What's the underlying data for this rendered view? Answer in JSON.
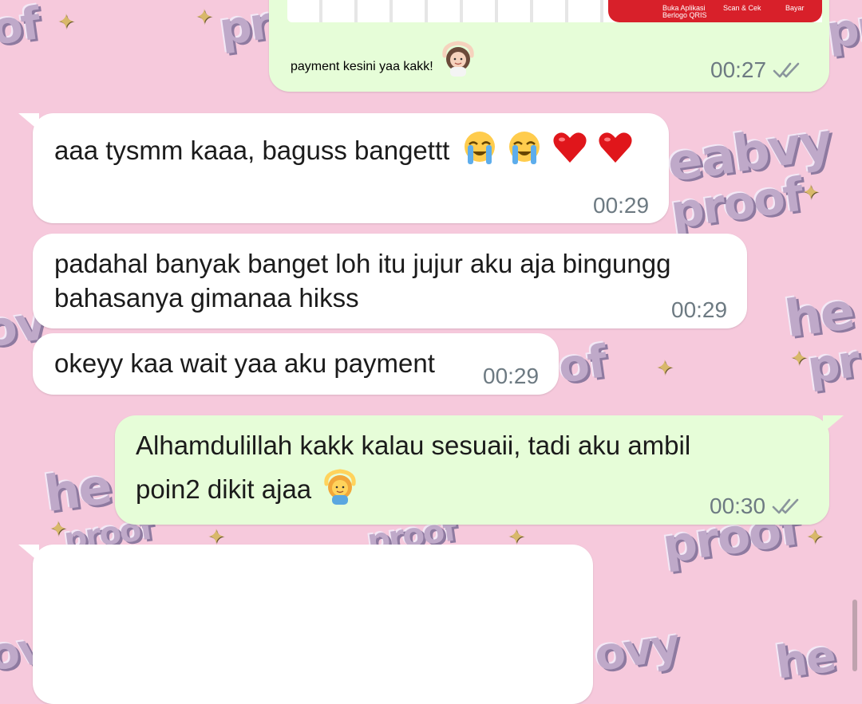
{
  "wallpaper": {
    "sticker_words": [
      "of",
      "pr",
      "pr",
      "eabvy",
      "proof",
      "ov",
      "he",
      "pr",
      "of",
      "he",
      "proof",
      "proof",
      "proof",
      "ov",
      "ovy",
      "he"
    ]
  },
  "shared_image": {
    "qris_labels": [
      "Buka Aplikasi",
      "Berlogo QRIS",
      "Scan & Cek",
      "Bayar"
    ]
  },
  "messages": [
    {
      "direction": "out",
      "text": "payment kesini yaa kakk!",
      "emoji": "person-gesturing-ok-icon",
      "time": "00:27",
      "status": "read"
    },
    {
      "direction": "in",
      "text": "aaa tysmm kaaa, baguss bangettt",
      "emoji_row": [
        "loudly-crying-face-icon",
        "loudly-crying-face-icon",
        "red-heart-icon",
        "red-heart-icon"
      ],
      "time": "00:29"
    },
    {
      "direction": "in",
      "lines": [
        "padahal banyak banget loh itu jujur aku aja bingungg",
        "bahasanya gimanaa hikss"
      ],
      "time": "00:29"
    },
    {
      "direction": "in",
      "text": "okeyy kaa wait yaa aku payment",
      "time": "00:29"
    },
    {
      "direction": "out",
      "lines": [
        "Alhamdulillah kakk kalau sesuaii, tadi aku ambil",
        "poin2 dikit ajaa"
      ],
      "emoji": "person-gesturing-ok-icon",
      "time": "00:30",
      "status": "read"
    }
  ],
  "colors": {
    "wallpaper": "#f6c9dc",
    "incoming_bubble": "#ffffff",
    "outgoing_bubble": "#e6fdd8",
    "timestamp": "#6d7a82",
    "read_ticks": "#8a959c",
    "qris_red": "#d8202a"
  }
}
